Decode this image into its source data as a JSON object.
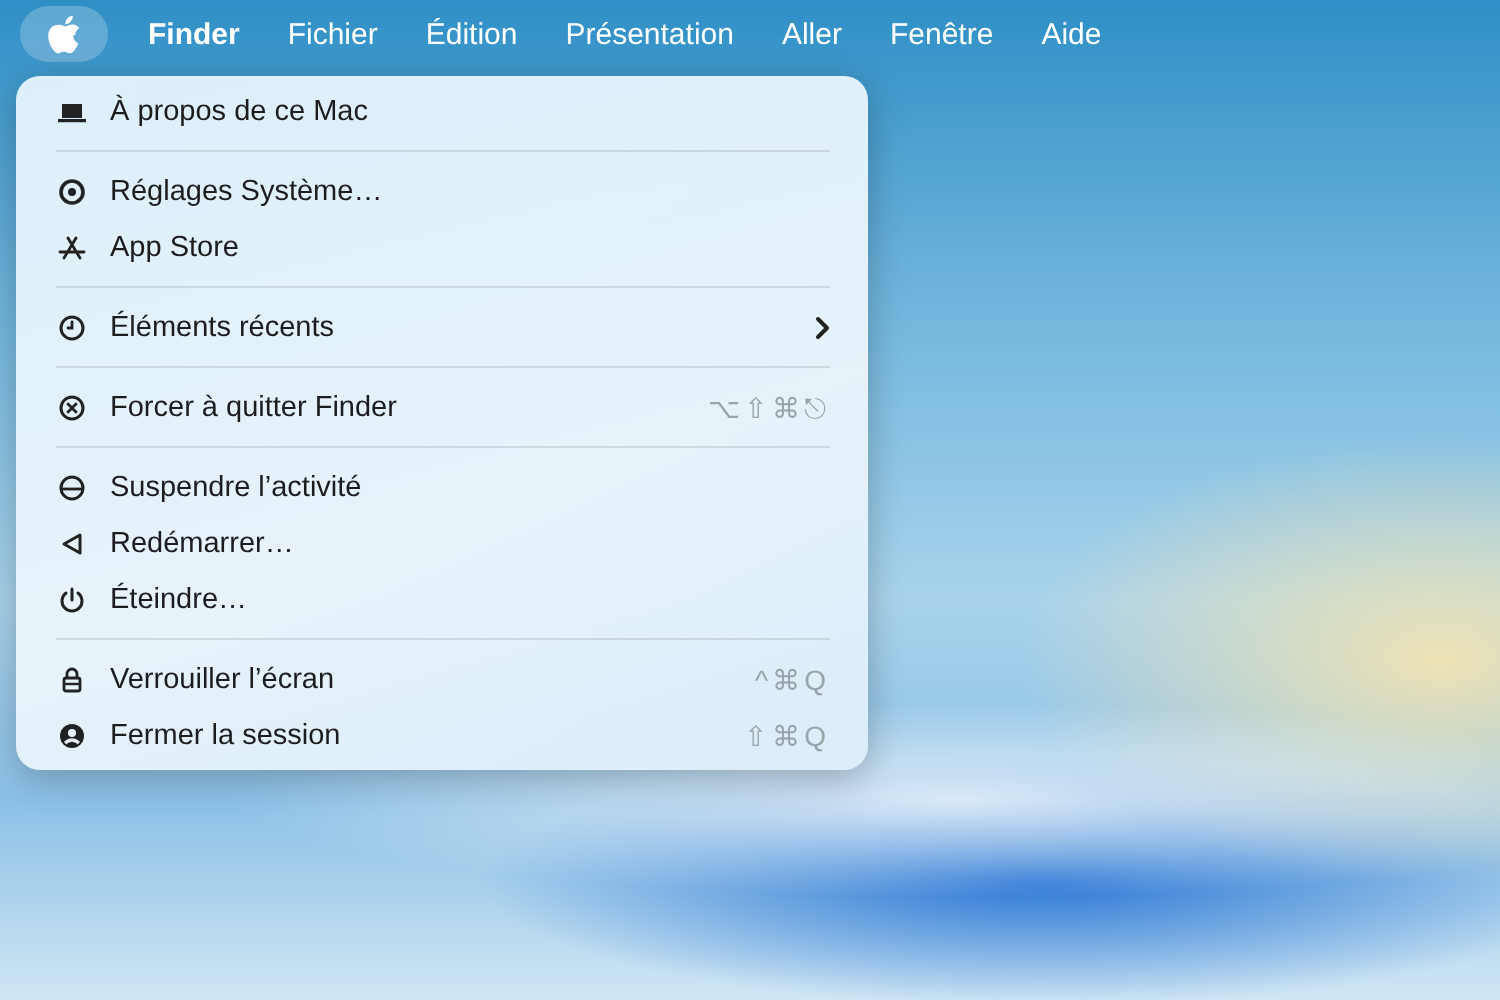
{
  "menu_bar": {
    "apple_menu": {
      "selected": true
    },
    "items": [
      {
        "label": "Finder",
        "kind": "app",
        "selected": false
      },
      {
        "label": "Fichier",
        "kind": "menu",
        "selected": false
      },
      {
        "label": "Édition",
        "kind": "menu",
        "selected": false
      },
      {
        "label": "Présentation",
        "kind": "menu",
        "selected": false
      },
      {
        "label": "Aller",
        "kind": "menu",
        "selected": false
      },
      {
        "label": "Fenêtre",
        "kind": "menu",
        "selected": false
      },
      {
        "label": "Aide",
        "kind": "menu",
        "selected": false
      }
    ]
  },
  "apple_menu": {
    "sections": [
      [
        {
          "kind": "laptop",
          "label": "À propos de ce Mac",
          "submenu": false
        }
      ],
      [
        {
          "kind": "gear",
          "label": "Réglages Système…",
          "submenu": false
        },
        {
          "kind": "appstore",
          "label": "App Store",
          "submenu": false
        }
      ],
      [
        {
          "kind": "clock",
          "label": "Éléments récents",
          "submenu": true
        }
      ],
      [
        {
          "kind": "xcircle",
          "label": "Forcer à quitter Finder",
          "shortcut": "⌥⇧⌘⎋",
          "submenu": false
        }
      ],
      [
        {
          "kind": "sleep",
          "label": "Suspendre l’activité",
          "submenu": false
        },
        {
          "kind": "restart",
          "label": "Redémarrer…",
          "submenu": false
        },
        {
          "kind": "power",
          "label": "Éteindre…",
          "submenu": false
        }
      ],
      [
        {
          "kind": "lock",
          "label": "Verrouiller l’écran",
          "shortcut": "^⌘Q",
          "submenu": false
        },
        {
          "kind": "person",
          "label": "Fermer la session",
          "shortcut": "⇧⌘Q",
          "submenu": false
        }
      ]
    ]
  }
}
